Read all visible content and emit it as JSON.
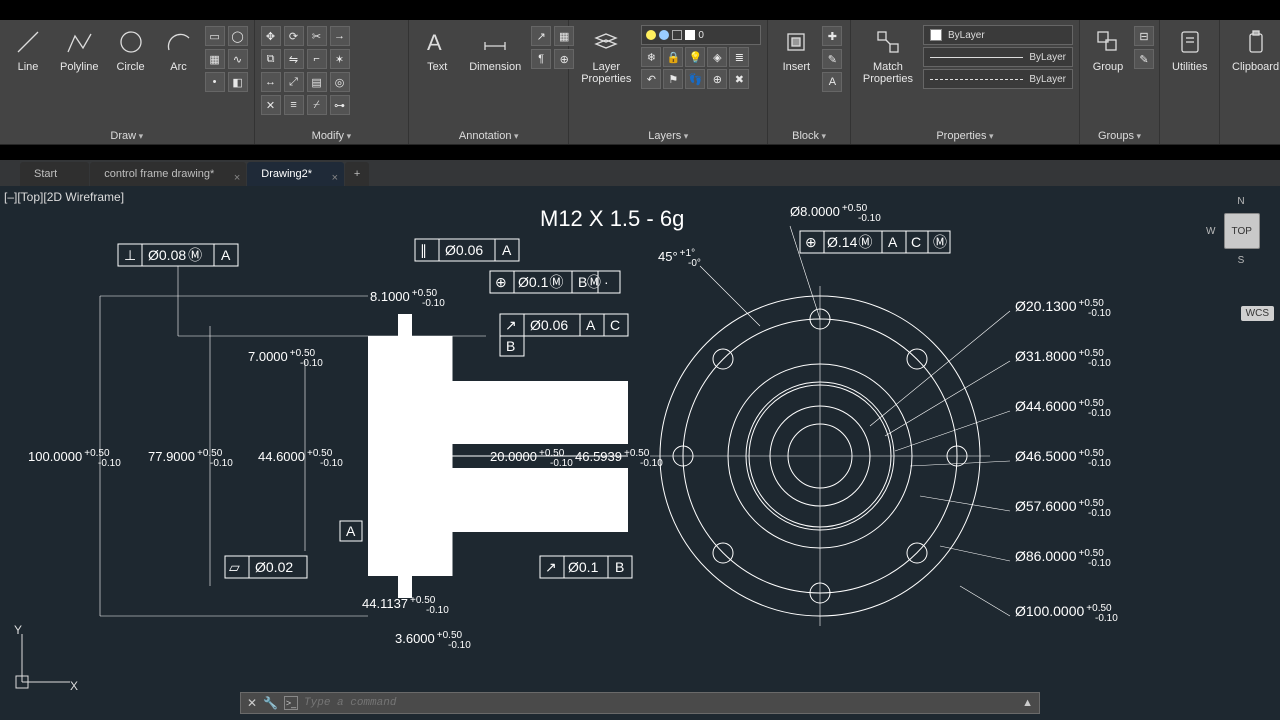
{
  "ribbon": {
    "draw": {
      "title": "Draw",
      "line": "Line",
      "polyline": "Polyline",
      "circle": "Circle",
      "arc": "Arc"
    },
    "modify": {
      "title": "Modify"
    },
    "annotation": {
      "title": "Annotation",
      "text": "Text",
      "dimension": "Dimension"
    },
    "layers": {
      "title": "Layers",
      "layerprops": "Layer\nProperties",
      "current": "0"
    },
    "block": {
      "title": "Block",
      "insert": "Insert"
    },
    "properties": {
      "title": "Properties",
      "match": "Match\nProperties",
      "bylayer": "ByLayer",
      "bylayer2": "ByLayer",
      "bylayer3": "ByLayer"
    },
    "groups": {
      "title": "Groups",
      "group": "Group"
    },
    "utilities": {
      "title": "Utilities"
    },
    "clipboard": {
      "title": "Clipboard"
    }
  },
  "tabs": {
    "start": "Start",
    "t1": "control frame drawing*",
    "t2": "Drawing2*"
  },
  "view": {
    "label": "[–][Top][2D Wireframe]",
    "navcube": "TOP",
    "navN": "N",
    "navW": "W",
    "navS": "S",
    "wcs": "WCS"
  },
  "ucs": {
    "x": "X",
    "y": "Y"
  },
  "cli": {
    "placeholder": "Type a command"
  },
  "dwg": {
    "thread": "M12 X 1.5 - 6g",
    "angle": "45°",
    "angtol_p": "+1°",
    "angtol_m": "-0°",
    "d100": "100.0000",
    "d77": "77.9000",
    "d44_6": "44.6000",
    "d7": "7.0000",
    "d8_1": "8.1000",
    "d20": "20.0000",
    "d46_59": "46.5939",
    "d44_11": "44.1137",
    "d3_6": "3.6000",
    "tol_p": "+0.50",
    "tol_m": "-0.10",
    "fcf_perp": "Ø0.08",
    "fcf_perp_m": "M",
    "fcf_perp_A": "A",
    "fcf_par": "Ø0.06",
    "fcf_par_A": "A",
    "fcf_pos1": "Ø0.1",
    "fcf_pos1_m": "M",
    "fcf_pos1_B": "B",
    "fcf_pos1_Bm": "M",
    "fcf_run1": "Ø0.06",
    "fcf_run1_A": "A",
    "fcf_run1_C": "C",
    "fcf_run2": "Ø0.1",
    "fcf_run2_B": "B",
    "fcf_flat": "Ø0.02",
    "fcf_r_dia8": "Ø8.0000",
    "fcf_r_pos": "Ø.14",
    "fcf_r_pos_m": "M",
    "fcf_r_pos_A": "A",
    "fcf_r_pos_C": "C",
    "fcf_r_pos_Cm": "M",
    "datum_A": "A",
    "datum_B": "B",
    "r20_13": "Ø20.1300",
    "r31_8": "Ø31.8000",
    "r44_6": "Ø44.6000",
    "r46_5": "Ø46.5000",
    "r57_6": "Ø57.6000",
    "r86": "Ø86.0000",
    "r100": "Ø100.0000"
  }
}
